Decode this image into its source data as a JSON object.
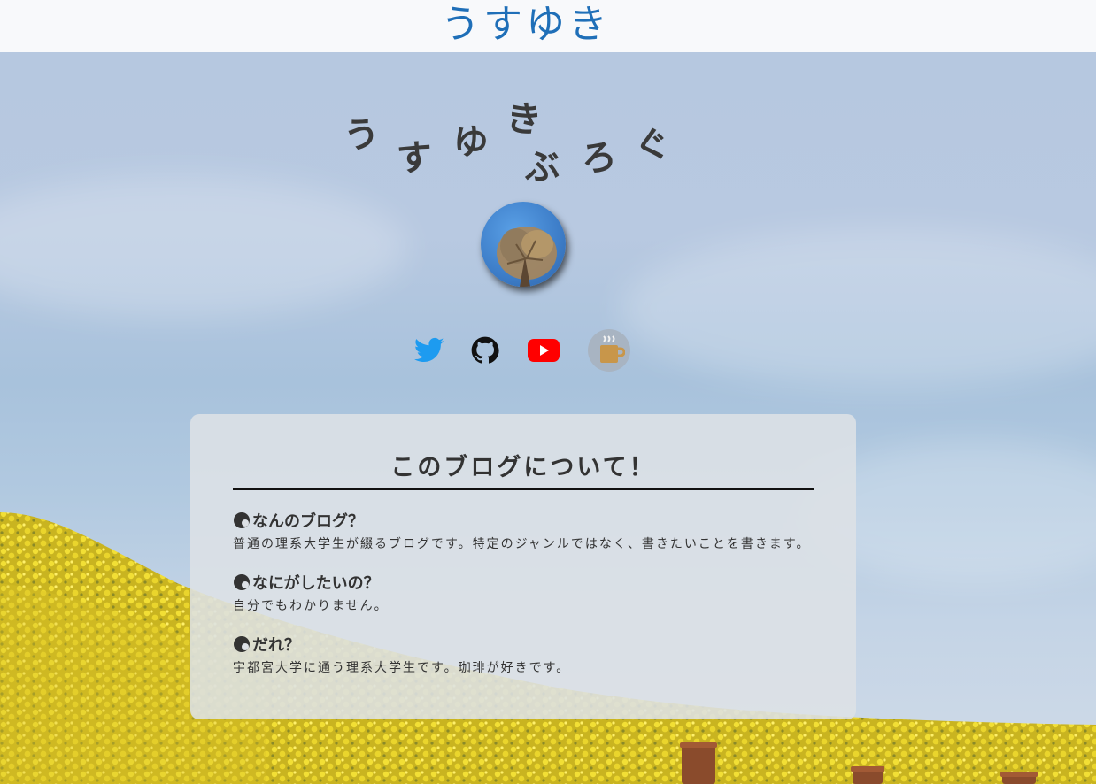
{
  "header": {
    "logo_text": "うすゆき"
  },
  "hero": {
    "title_line1": [
      "う",
      "す",
      "ゆ",
      "き"
    ],
    "title_line2": [
      "ぶ",
      "ろ",
      "ぐ"
    ]
  },
  "social": [
    {
      "name": "twitter-link",
      "icon": "twitter-icon",
      "color": "#1d9bf0"
    },
    {
      "name": "github-link",
      "icon": "github-icon",
      "color": "#111111"
    },
    {
      "name": "youtube-link",
      "icon": "youtube-icon",
      "color": "#ff0000"
    },
    {
      "name": "coffee-link",
      "icon": "coffee-icon",
      "color": "#c8964a"
    }
  ],
  "about": {
    "title": "このブログについて！",
    "items": [
      {
        "question": "なんのブログ？",
        "answer": "普通の理系大学生が綴るブログです。特定のジャンルではなく、書きたいことを書きます。"
      },
      {
        "question": "なにがしたいの？",
        "answer": "自分でもわかりません。"
      },
      {
        "question": "だれ？",
        "answer": "宇都宮大学に通う理系大学生です。珈琲が好きです。"
      }
    ]
  }
}
